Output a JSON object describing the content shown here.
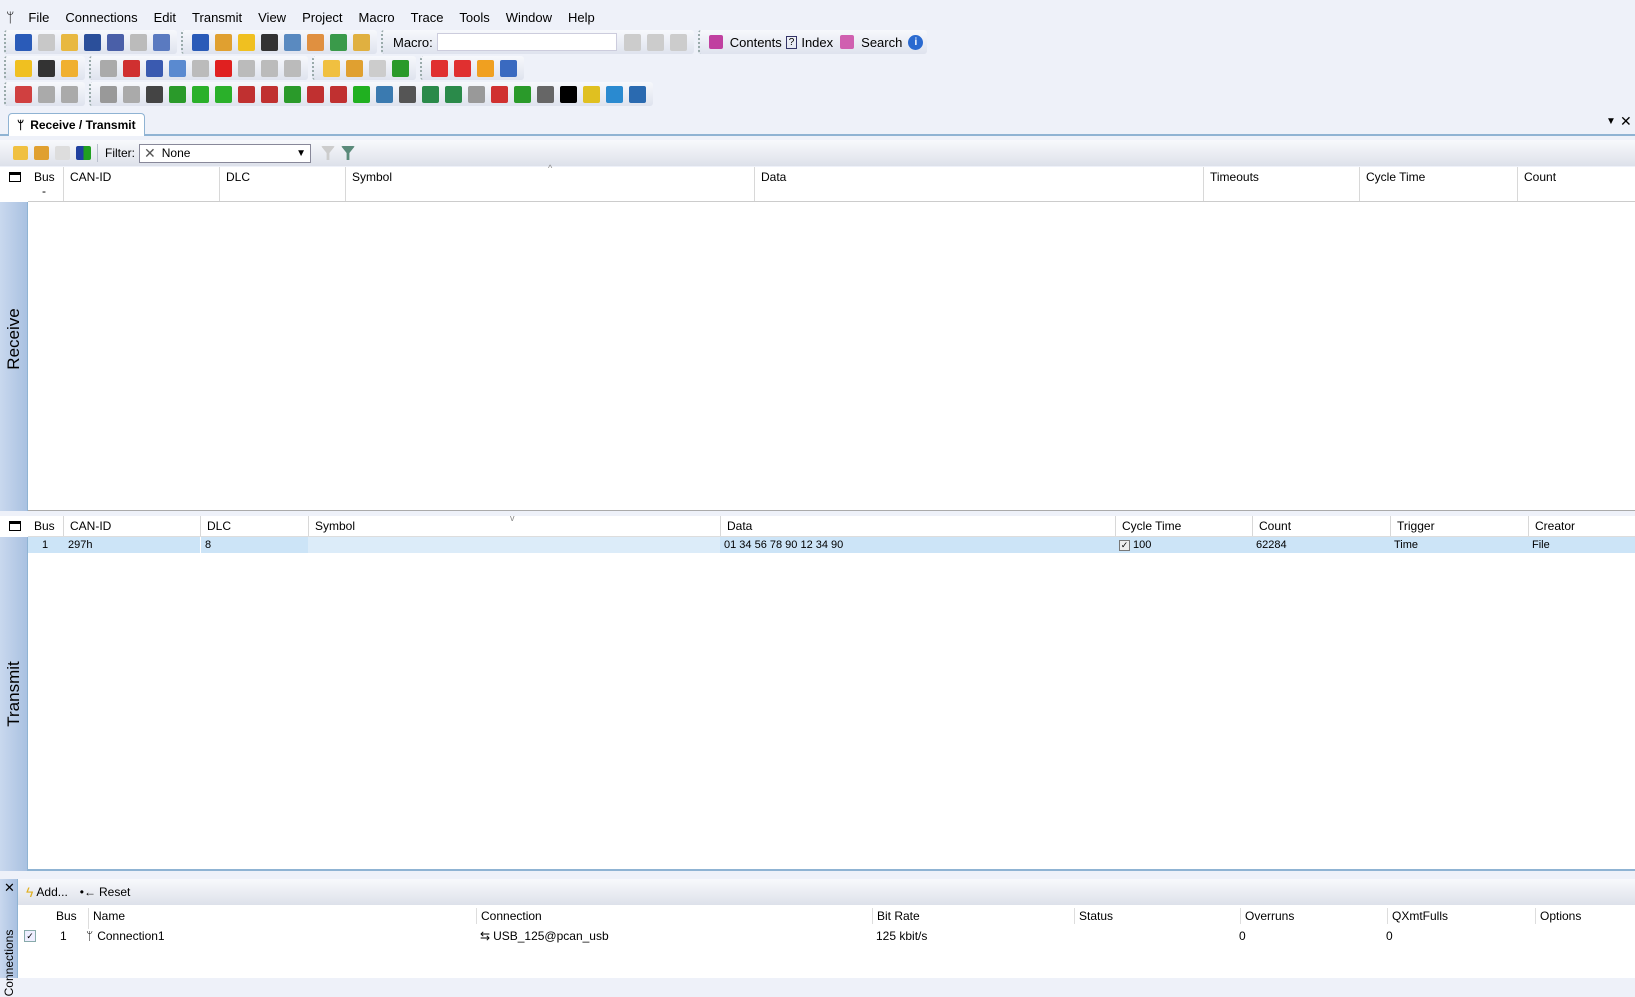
{
  "menu": {
    "items": [
      "File",
      "Connections",
      "Edit",
      "Transmit",
      "View",
      "Project",
      "Macro",
      "Trace",
      "Tools",
      "Window",
      "Help"
    ]
  },
  "toolbar1": {
    "group_a": [
      {
        "n": "new-project-icon",
        "c": "#2a5bb8"
      },
      {
        "n": "new-icon",
        "c": "#c8c8c8"
      },
      {
        "n": "open-folder-icon",
        "c": "#e8b840"
      },
      {
        "n": "save-icon",
        "c": "#2b4f9a"
      },
      {
        "n": "save-all-icon",
        "c": "#4a5fa8"
      },
      {
        "n": "print-icon",
        "c": "#bbb"
      },
      {
        "n": "checklist-icon",
        "c": "#5a7ac0"
      }
    ],
    "group_b": [
      {
        "n": "receive-transmit-icon",
        "c": "#2a5bb8"
      },
      {
        "n": "project-window-icon",
        "c": "#e0a030"
      },
      {
        "n": "connections-window-icon",
        "c": "#f0c020"
      },
      {
        "n": "tools-icon",
        "c": "#333"
      },
      {
        "n": "trace-icon",
        "c": "#5a8ac0"
      },
      {
        "n": "statistics-icon",
        "c": "#e09040"
      },
      {
        "n": "symbols-icon",
        "c": "#3a9a4a"
      },
      {
        "n": "message-icon",
        "c": "#e0b040"
      }
    ],
    "macro_label": "Macro:",
    "macro_value": "",
    "group_c": [
      {
        "n": "macro-record-icon",
        "c": "#ccc"
      },
      {
        "n": "macro-play-icon",
        "c": "#ccc"
      },
      {
        "n": "macro-stop-icon",
        "c": "#ccc"
      }
    ],
    "help_contents": "Contents",
    "help_index": "Index",
    "help_search": "Search"
  },
  "toolbar2": {
    "group_a": [
      {
        "n": "connect-icon",
        "c": "#f0c020"
      },
      {
        "n": "reset-icon",
        "c": "#333"
      },
      {
        "n": "clock-icon",
        "c": "#f0b030"
      }
    ],
    "group_b": [
      {
        "n": "check-icon",
        "c": "#aaa"
      },
      {
        "n": "delete-doc-icon",
        "c": "#d03030"
      },
      {
        "n": "cut-icon",
        "c": "#3a5ab0"
      },
      {
        "n": "copy-icon",
        "c": "#5a8ad0"
      },
      {
        "n": "paste-icon",
        "c": "#bbb"
      },
      {
        "n": "delete-icon",
        "c": "#e02020"
      },
      {
        "n": "undo-icon",
        "c": "#bbb"
      },
      {
        "n": "redo-icon",
        "c": "#bbb"
      },
      {
        "n": "find-icon",
        "c": "#bbb"
      }
    ],
    "group_c": [
      {
        "n": "new-message-icon",
        "c": "#f0c040"
      },
      {
        "n": "edit-message-icon",
        "c": "#e0a030"
      },
      {
        "n": "message-disabled-icon",
        "c": "#ccc"
      },
      {
        "n": "pause-play-icon",
        "c": "#2a9a2a"
      }
    ],
    "group_d": [
      {
        "n": "add-record-icon",
        "c": "#e03030"
      },
      {
        "n": "record-icon",
        "c": "#e03030"
      },
      {
        "n": "pause-icon",
        "c": "#f0a020"
      },
      {
        "n": "window-icon",
        "c": "#3a6ac0"
      }
    ]
  },
  "toolbar3": {
    "group_a": [
      {
        "n": "chart-icon",
        "c": "#d04040"
      },
      {
        "n": "chart-disabled-icon",
        "c": "#aaa"
      },
      {
        "n": "chart-grid-icon",
        "c": "#aaa"
      }
    ],
    "group_b": [
      {
        "n": "pointer-icon",
        "c": "#999"
      },
      {
        "n": "lightning-icon",
        "c": "#aaa"
      },
      {
        "n": "numeric-display-icon",
        "c": "#444"
      },
      {
        "n": "led-display-icon",
        "c": "#2a9a2a"
      },
      {
        "n": "vertical-bar-icon",
        "c": "#2ab02a"
      },
      {
        "n": "horizontal-bar-icon",
        "c": "#2ab02a"
      },
      {
        "n": "gauge-icon",
        "c": "#c03030"
      },
      {
        "n": "gauge2-icon",
        "c": "#c03030"
      },
      {
        "n": "gauge3-icon",
        "c": "#2a9a2a"
      },
      {
        "n": "slider-icon",
        "c": "#c03030"
      },
      {
        "n": "meter-icon",
        "c": "#c03030"
      },
      {
        "n": "lamp-icon",
        "c": "#20b020"
      },
      {
        "n": "step-chart-icon",
        "c": "#3a7ab0"
      },
      {
        "n": "button-icon",
        "c": "#555"
      },
      {
        "n": "switch-icon",
        "c": "#2a8a4a"
      },
      {
        "n": "multi-switch-icon",
        "c": "#2a8a4a"
      },
      {
        "n": "sun-icon",
        "c": "#999"
      },
      {
        "n": "red-bar-icon",
        "c": "#d03030"
      },
      {
        "n": "green-bar-icon",
        "c": "#2a9a2a"
      },
      {
        "n": "edit-text-icon",
        "c": "#666"
      },
      {
        "n": "text-icon",
        "c": "#000"
      },
      {
        "n": "digital-clock-icon",
        "c": "#e0c020"
      },
      {
        "n": "picture-icon",
        "c": "#2a8ad0"
      },
      {
        "n": "layers-icon",
        "c": "#2a6ab0"
      }
    ]
  },
  "tab": {
    "label": "Receive / Transmit"
  },
  "filter": {
    "label": "Filter:",
    "value": "None"
  },
  "receive": {
    "label": "Receive",
    "columns": [
      "Bus",
      "CAN-ID",
      "DLC",
      "Symbol",
      "Data",
      "Timeouts",
      "Cycle Time",
      "Count"
    ],
    "bus_sub": "-"
  },
  "transmit": {
    "label": "Transmit",
    "columns": [
      "Bus",
      "CAN-ID",
      "DLC",
      "Symbol",
      "Data",
      "Cycle Time",
      "Count",
      "Trigger",
      "Creator"
    ],
    "rows": [
      {
        "bus": "1",
        "can_id": "297h",
        "dlc": "8",
        "symbol": "",
        "data": "01 34 56 78 90 12 34 90",
        "cycle_enabled": true,
        "cycle_time": "100",
        "count": "62284",
        "trigger": "Time",
        "creator": "File"
      }
    ]
  },
  "connections": {
    "label": "Connections",
    "add_label": "Add...",
    "reset_label": "Reset",
    "columns": [
      "Bus",
      "Name",
      "Connection",
      "Bit Rate",
      "Status",
      "Overruns",
      "QXmtFulls",
      "Options"
    ],
    "rows": [
      {
        "enabled": true,
        "bus": "1",
        "name": "Connection1",
        "connection": "USB_125@pcan_usb",
        "bit_rate": "125 kbit/s",
        "status": "",
        "overruns": "0",
        "qxmtfulls": "0",
        "options": ""
      }
    ]
  },
  "colors": {
    "selection": "#cce4f7",
    "sidebar": "#b4c9e6",
    "border": "#8fb3d3"
  }
}
